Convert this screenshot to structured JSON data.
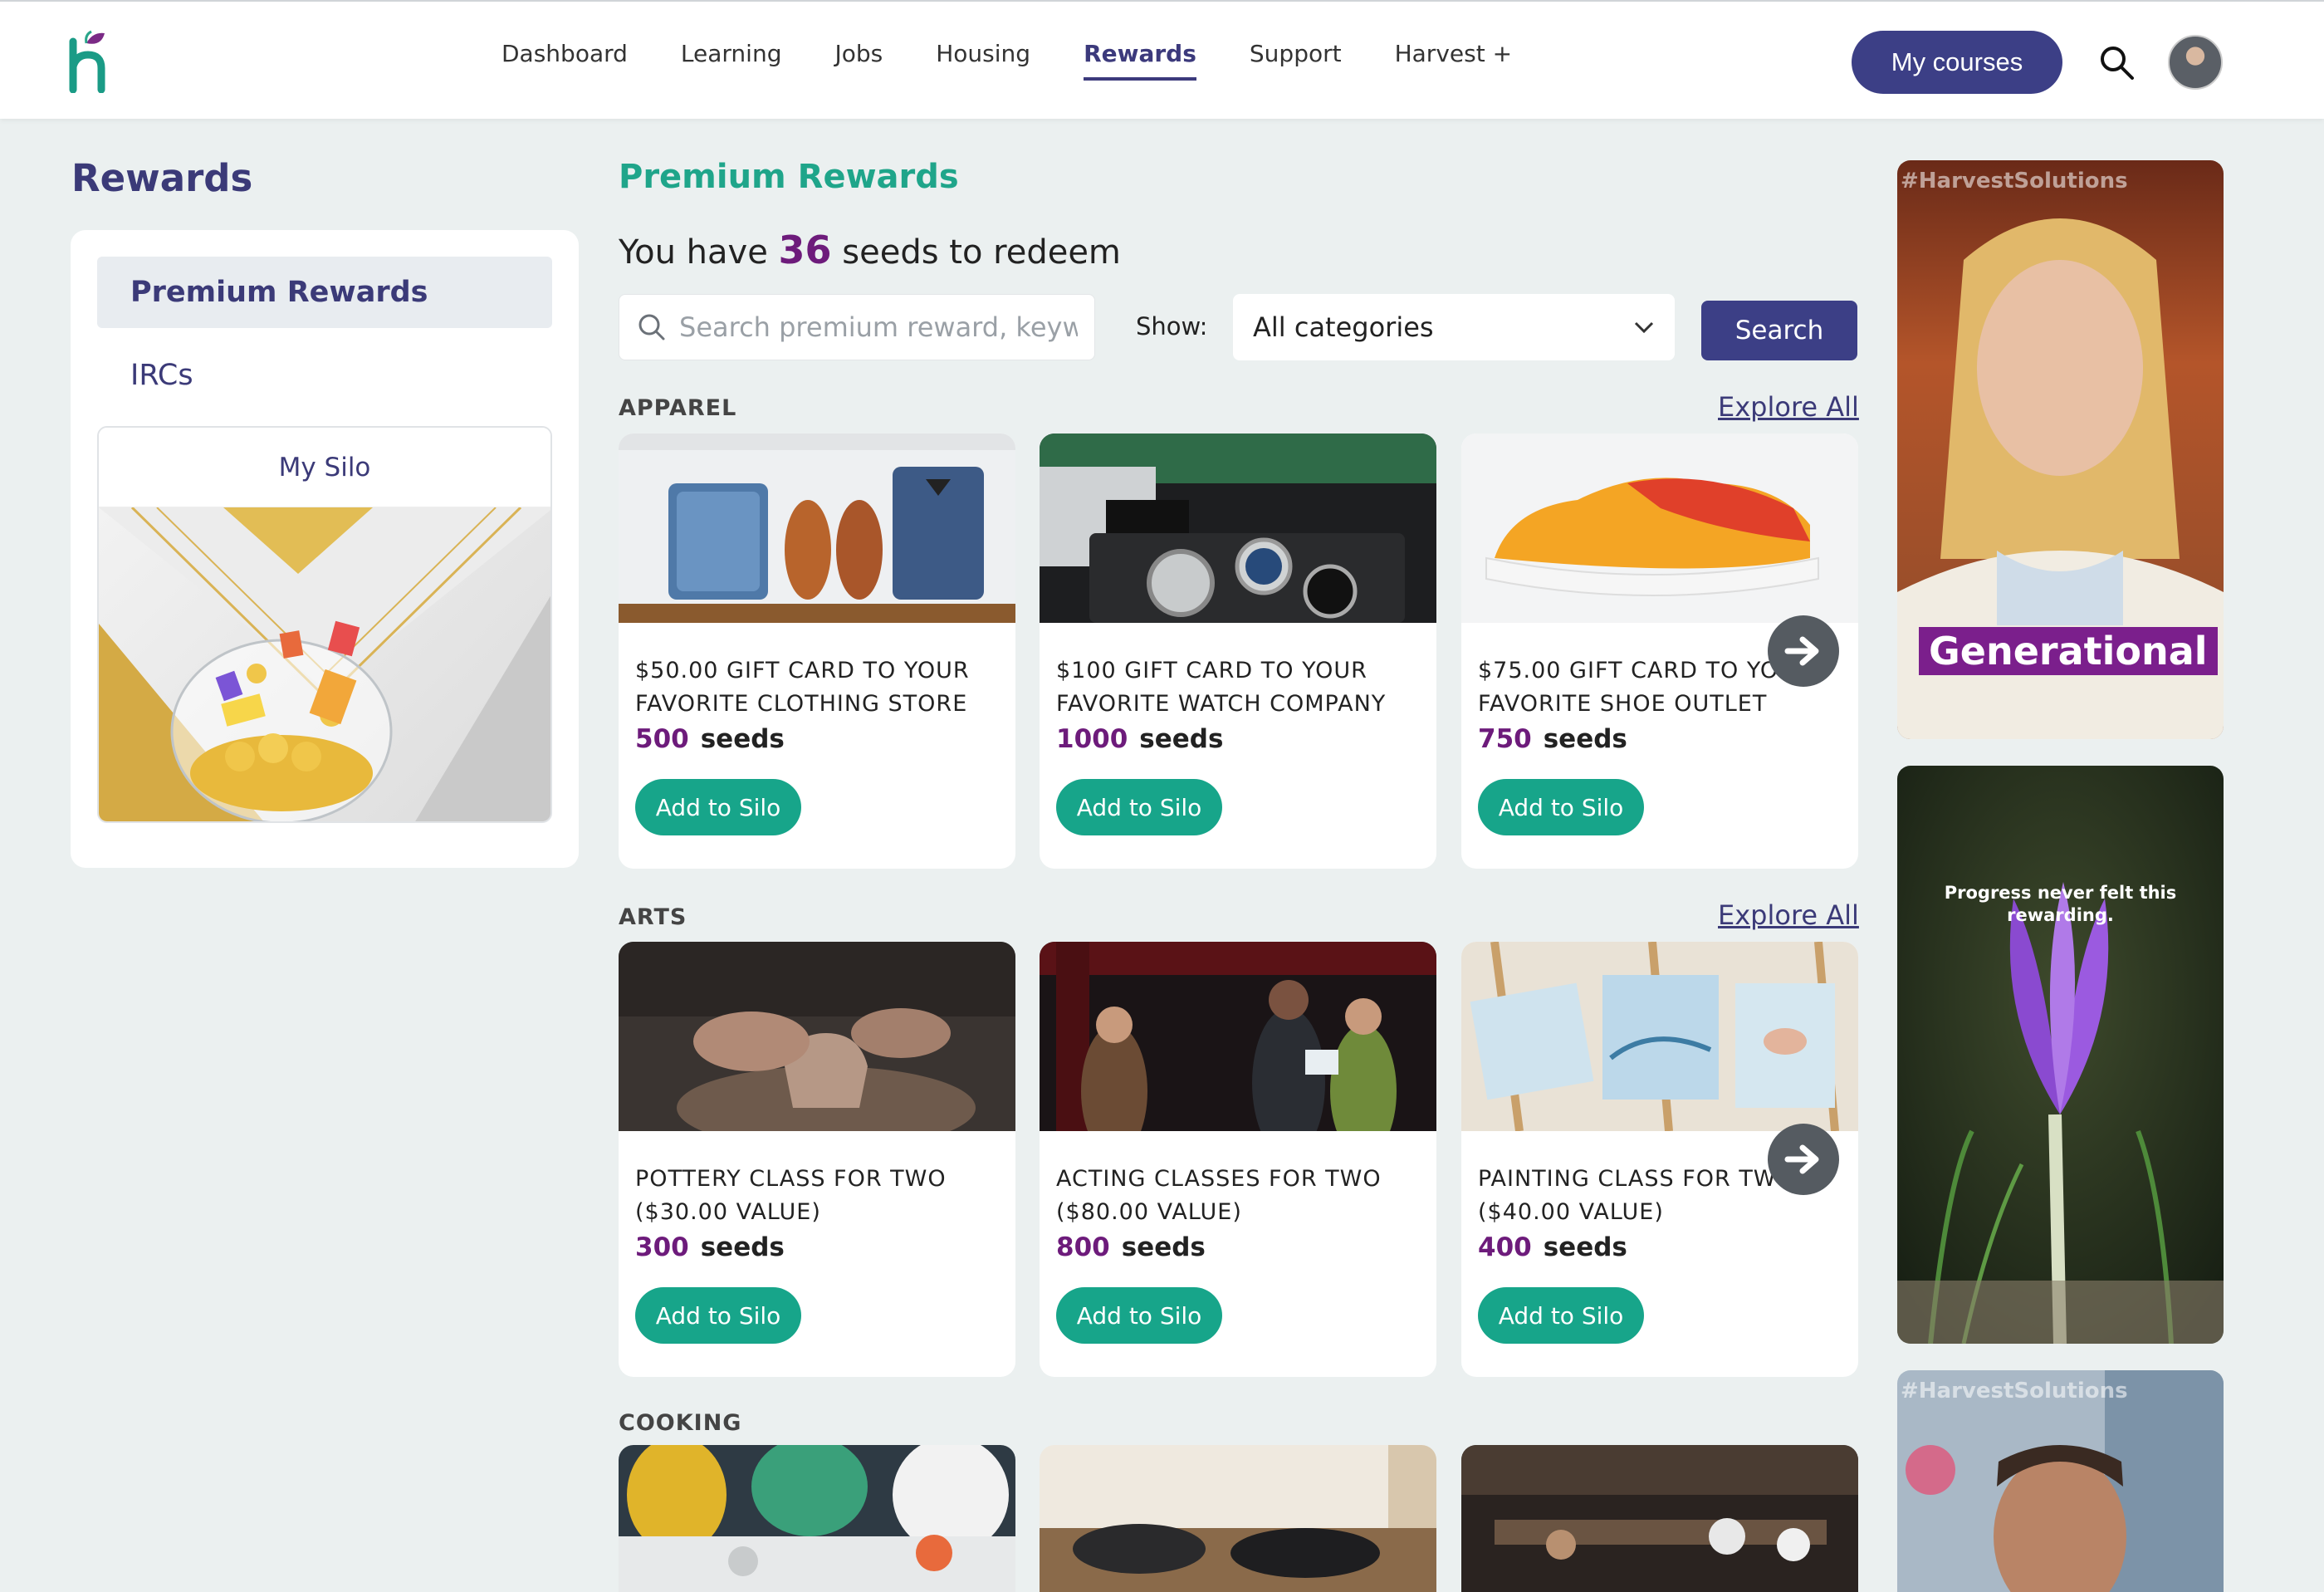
{
  "nav": {
    "items": [
      "Dashboard",
      "Learning",
      "Jobs",
      "Housing",
      "Rewards",
      "Support",
      "Harvest +"
    ],
    "active": "Rewards",
    "my_courses": "My courses"
  },
  "sidebar": {
    "title": "Rewards",
    "items": [
      {
        "label": "Premium Rewards",
        "active": true
      },
      {
        "label": "IRCs",
        "active": false
      }
    ],
    "silo_label": "My Silo"
  },
  "main": {
    "title": "Premium Rewards",
    "seeds_prefix": "You have",
    "seeds_count": "36",
    "seeds_suffix": "seeds to redeem",
    "search_placeholder": "Search premium reward, keyw",
    "show_label": "Show:",
    "category_selected": "All categories",
    "search_button": "Search",
    "explore_all": "Explore All",
    "sections": [
      {
        "label": "APPAREL",
        "cards": [
          {
            "title": "$50.00 GIFT CARD TO YOUR FAVORITE CLOTHING STORE",
            "price": "500",
            "unit": "seeds",
            "button": "Add to Silo"
          },
          {
            "title": "$100 GIFT CARD TO YOUR FAVORITE WATCH COMPANY",
            "price": "1000",
            "unit": "seeds",
            "button": "Add to Silo"
          },
          {
            "title": "$75.00 GIFT CARD TO YOUR FAVORITE SHOE OUTLET",
            "price": "750",
            "unit": "seeds",
            "button": "Add to Silo"
          }
        ]
      },
      {
        "label": "ARTS",
        "cards": [
          {
            "title": "POTTERY CLASS FOR TWO ($30.00 VALUE)",
            "price": "300",
            "unit": "seeds",
            "button": "Add to Silo"
          },
          {
            "title": "ACTING CLASSES FOR TWO ($80.00 VALUE)",
            "price": "800",
            "unit": "seeds",
            "button": "Add to Silo"
          },
          {
            "title": "PAINTING CLASS FOR TWO ($40.00 VALUE)",
            "price": "400",
            "unit": "seeds",
            "button": "Add to Silo"
          }
        ]
      },
      {
        "label": "COOKING"
      }
    ]
  },
  "videos": [
    {
      "tag": "#HarvestSolutions",
      "caption": "Generational"
    },
    {
      "caption": "Progress never felt this rewarding."
    },
    {
      "tag": "#HarvestSolutions"
    }
  ],
  "colors": {
    "brand_navy": "#3c3f86",
    "brand_green": "#17a58a",
    "seed_purple": "#6d1b7b",
    "background": "#ebf0f0"
  }
}
